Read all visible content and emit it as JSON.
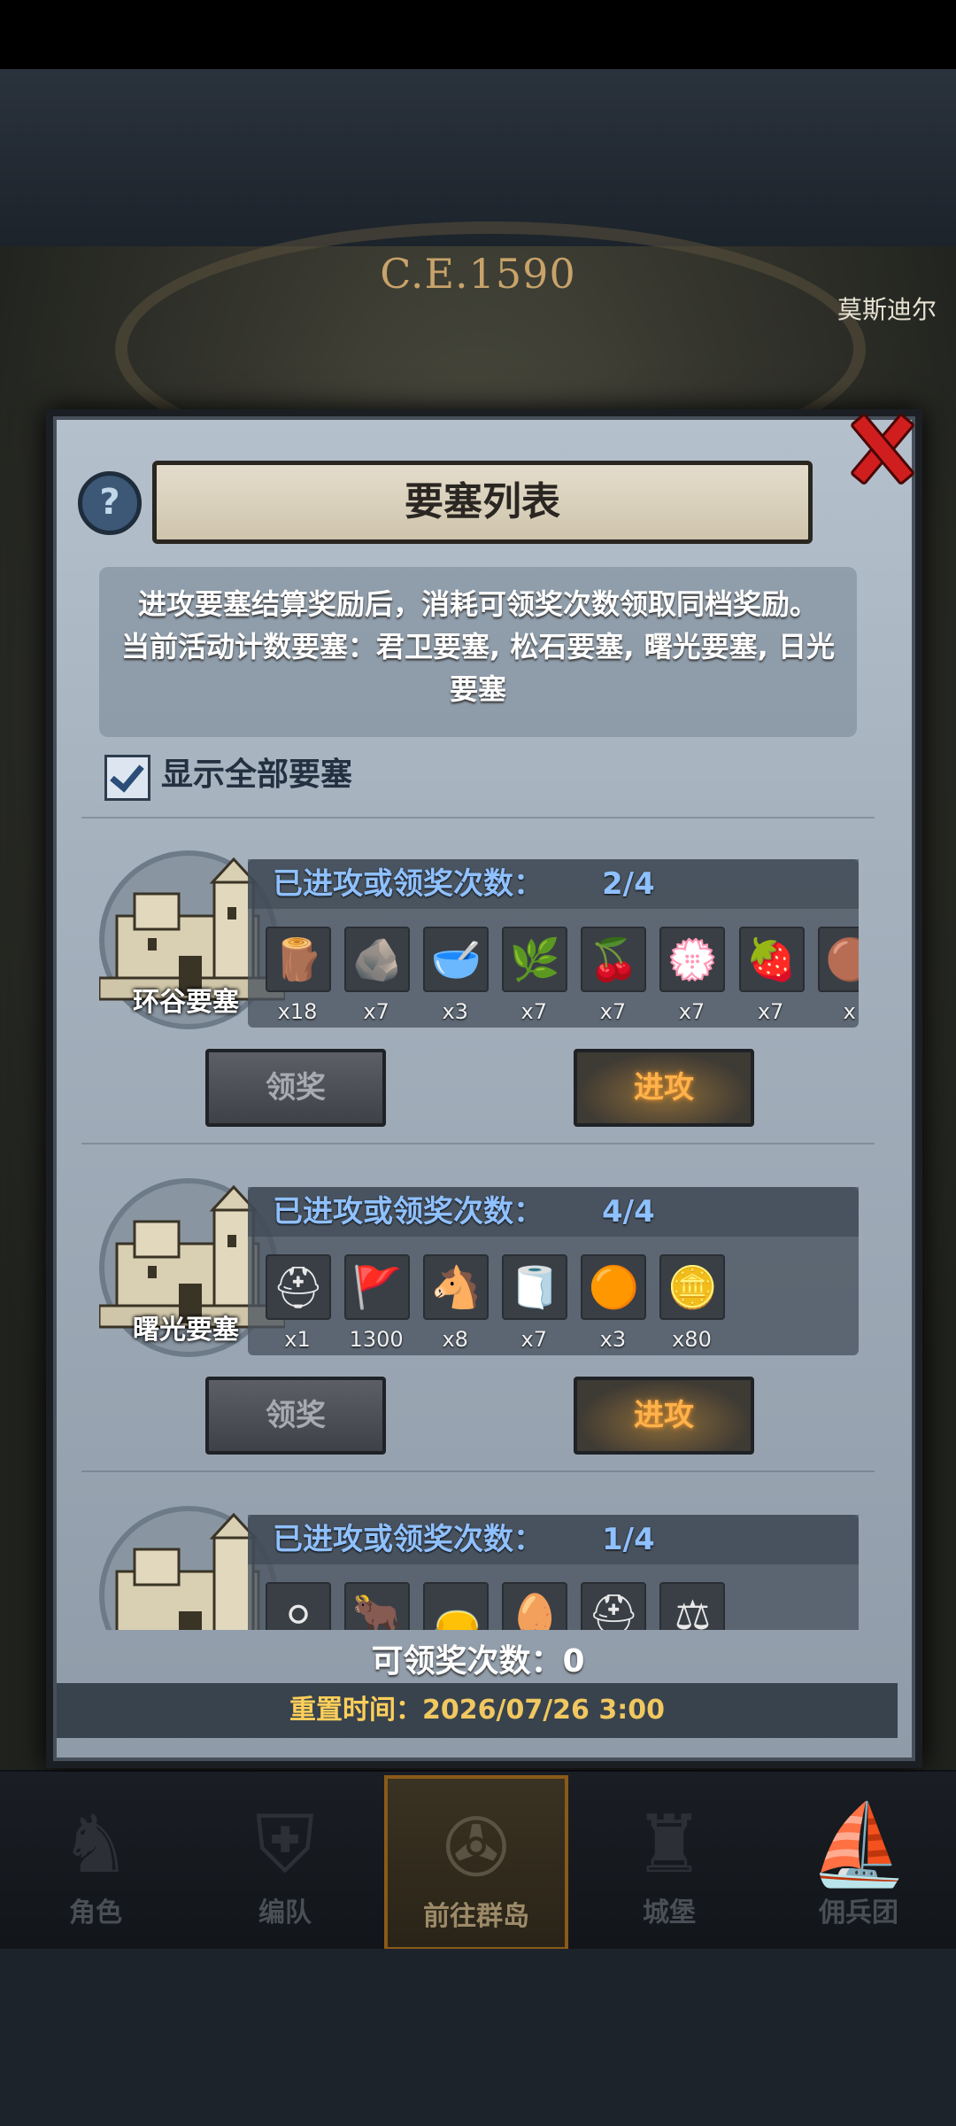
{
  "background": {
    "era_label": "C.E.1590",
    "town_label": "莫斯迪尔"
  },
  "dialog": {
    "title": "要塞列表",
    "help_icon": "?",
    "close_icon": "close-x",
    "info_lines": [
      "进攻要塞结算奖励后，消耗可领奖次数领取同档奖励。",
      "当前活动计数要塞：君卫要塞, 松石要塞, 曙光要塞, 日光",
      "要塞"
    ],
    "show_all_label": "显示全部要塞",
    "show_all_checked": true,
    "claim_count_label": "可领奖次数：",
    "claim_count_value": "0",
    "reset_label": "重置时间：",
    "reset_value": "2026/07/26 3:00"
  },
  "fortresses": [
    {
      "name": "环谷要塞",
      "count_label": "已进攻或领奖次数：",
      "count_value": "2/4",
      "claim_label": "领奖",
      "attack_label": "进攻",
      "rewards": [
        {
          "icon": "wood-log",
          "glyph": "🪵",
          "qty": "x18"
        },
        {
          "icon": "iron-ore",
          "glyph": "🪨",
          "qty": "x7"
        },
        {
          "icon": "salt-bowl",
          "glyph": "🥣",
          "qty": "x3"
        },
        {
          "icon": "herb-sprig",
          "glyph": "🌿",
          "qty": "x7"
        },
        {
          "icon": "red-berries",
          "glyph": "🍒",
          "qty": "x7"
        },
        {
          "icon": "white-flowers",
          "glyph": "💮",
          "qty": "x7"
        },
        {
          "icon": "holly-berries",
          "glyph": "🍓",
          "qty": "x7"
        },
        {
          "icon": "bronze-item",
          "glyph": "🟤",
          "qty": "x"
        }
      ]
    },
    {
      "name": "曙光要塞",
      "count_label": "已进攻或领奖次数：",
      "count_value": "4/4",
      "claim_label": "领奖",
      "attack_label": "进攻",
      "rewards": [
        {
          "icon": "knight-helmet",
          "glyph": "⛑",
          "qty": "x1"
        },
        {
          "icon": "red-banner",
          "glyph": "🚩",
          "qty": "1300"
        },
        {
          "icon": "horse",
          "glyph": "🐴",
          "qty": "x8"
        },
        {
          "icon": "cloth-roll",
          "glyph": "🧻",
          "qty": "x7"
        },
        {
          "icon": "caviar",
          "glyph": "🟠",
          "qty": "x3"
        },
        {
          "icon": "gold-coin",
          "glyph": "🪙",
          "qty": "x80"
        }
      ]
    },
    {
      "name": "",
      "count_label": "已进攻或领奖次数：",
      "count_value": "1/4",
      "claim_label": "领奖",
      "attack_label": "进攻",
      "rewards": [
        {
          "icon": "pearls",
          "glyph": "⚪",
          "qty": ""
        },
        {
          "icon": "ox",
          "glyph": "🐂",
          "qty": ""
        },
        {
          "icon": "sack",
          "glyph": "👝",
          "qty": ""
        },
        {
          "icon": "white-gem",
          "glyph": "🥚",
          "qty": ""
        },
        {
          "icon": "knight-helmet",
          "glyph": "⛑",
          "qty": ""
        },
        {
          "icon": "scales-card",
          "glyph": "⚖",
          "qty": ""
        }
      ]
    }
  ],
  "bottom_nav": [
    {
      "label": "角色",
      "icon": "knight-icon",
      "glyph": "♞",
      "active": false
    },
    {
      "label": "编队",
      "icon": "helmet-icon",
      "glyph": "⛨",
      "active": false
    },
    {
      "label": "前往群岛",
      "icon": "compass-icon",
      "glyph": "✇",
      "active": true
    },
    {
      "label": "城堡",
      "icon": "castle-icon",
      "glyph": "♜",
      "active": false
    },
    {
      "label": "佣兵团",
      "icon": "ship-icon",
      "glyph": "⛵",
      "active": false
    }
  ]
}
